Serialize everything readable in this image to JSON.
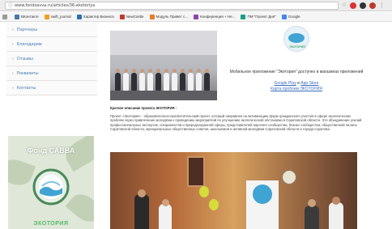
{
  "browser": {
    "url": "www.fondsavva.ru/articles/36-ekotoriya",
    "bookmarks": [
      "ВКонтакте",
      "swift_journal",
      "Характер Бизнеса",
      "NewCastle",
      "Модуль Привет с...",
      "Конференция + Не...",
      "ПМ \"Проект Дня\"",
      "Google"
    ]
  },
  "sidebar": {
    "items": [
      {
        "label": "Партнеры"
      },
      {
        "label": "Благодарим"
      },
      {
        "label": "Отзывы"
      },
      {
        "label": "Реквизиты"
      },
      {
        "label": "Контакты"
      }
    ],
    "banner_title": "Фонд САВВА",
    "banner_subtitle": "ЭКОТОРИЯ"
  },
  "app": {
    "logo_text": "ЭКОТОРИЯ",
    "availability_text": "Мобильное приложение \"Экотория\" доступно в магазинах приложений",
    "google_play": "Google Play",
    "and": "и",
    "app_store": "App Store",
    "map_link": "Карта проблем ЭКОТОРИЯ"
  },
  "description": {
    "heading": "Краткое описание проекта ЭКОТОРИЯ :",
    "body": "Проект «Экотория» - образовательно-просветительский проект, который направлен на активизацию форм гражданского участия в сфере экологических проблем через привлечение молодёжи к проведению мероприятий по улучшению экологической обстановки в Саратовской области. Это объединение усилий профессиональных экспертов, специалистов и природоохранной сферы, представителей научного сообщества, бизнес-сообщества, общественной палаты Саратовской области, муниципальных общественных советов, школьников и активной молодёжи Саратовской области и города Саратова."
  },
  "colors": {
    "link": "#3a6ebd",
    "nav_text": "#4a7fb5",
    "brand_green": "#46a963",
    "brand_blue": "#3fa3d3"
  }
}
